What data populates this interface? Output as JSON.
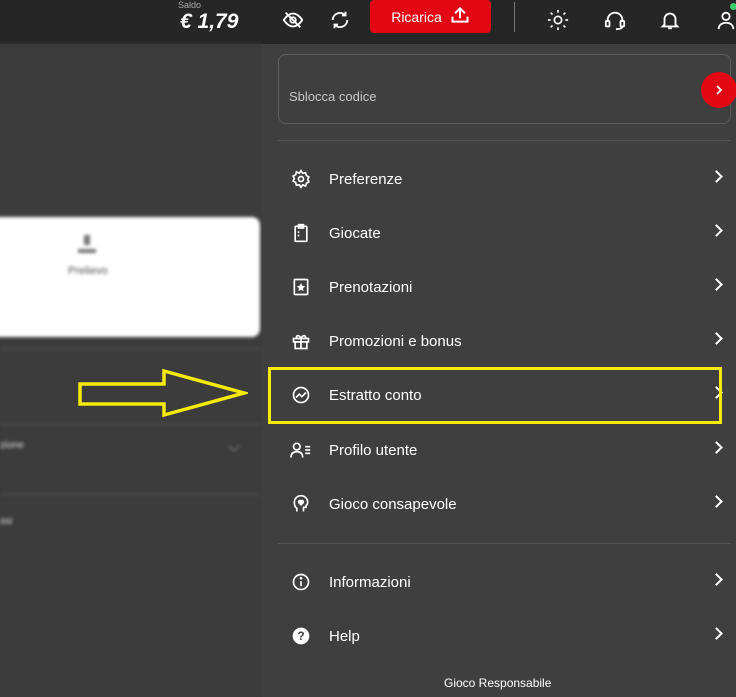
{
  "header": {
    "saldo_label": "Saldo",
    "saldo_value": "€ 1,79",
    "ricarica_label": "Ricarica",
    "icons": [
      "eye-off-icon",
      "refresh-icon",
      "upload-icon",
      "sun-icon",
      "headset-icon",
      "bell-icon",
      "user-icon"
    ],
    "accent": "#e30613",
    "online_color": "#3bd16f"
  },
  "left_panel": {
    "card_label": "Prelievo",
    "row1_text": "zione",
    "row2_text": "ssi"
  },
  "panel": {
    "code_placeholder": "Sblocca codice",
    "menu": [
      {
        "label": "Preferenze",
        "icon": "settings-icon"
      },
      {
        "label": "Giocate",
        "icon": "clipboard-icon"
      },
      {
        "label": "Prenotazioni",
        "icon": "bookmark-star-icon"
      },
      {
        "label": "Promozioni e bonus",
        "icon": "gift-icon"
      },
      {
        "label": "Estratto conto",
        "icon": "trend-icon"
      },
      {
        "label": "Profilo utente",
        "icon": "user-list-icon"
      },
      {
        "label": "Gioco consapevole",
        "icon": "head-heart-icon"
      }
    ],
    "menu2": [
      {
        "label": "Informazioni",
        "icon": "info-icon"
      },
      {
        "label": "Help",
        "icon": "help-icon"
      }
    ],
    "footer": "Gioco Responsabile"
  },
  "annotation": {
    "highlight_color": "#f5ea0a",
    "highlight_target": "Estratto conto"
  }
}
